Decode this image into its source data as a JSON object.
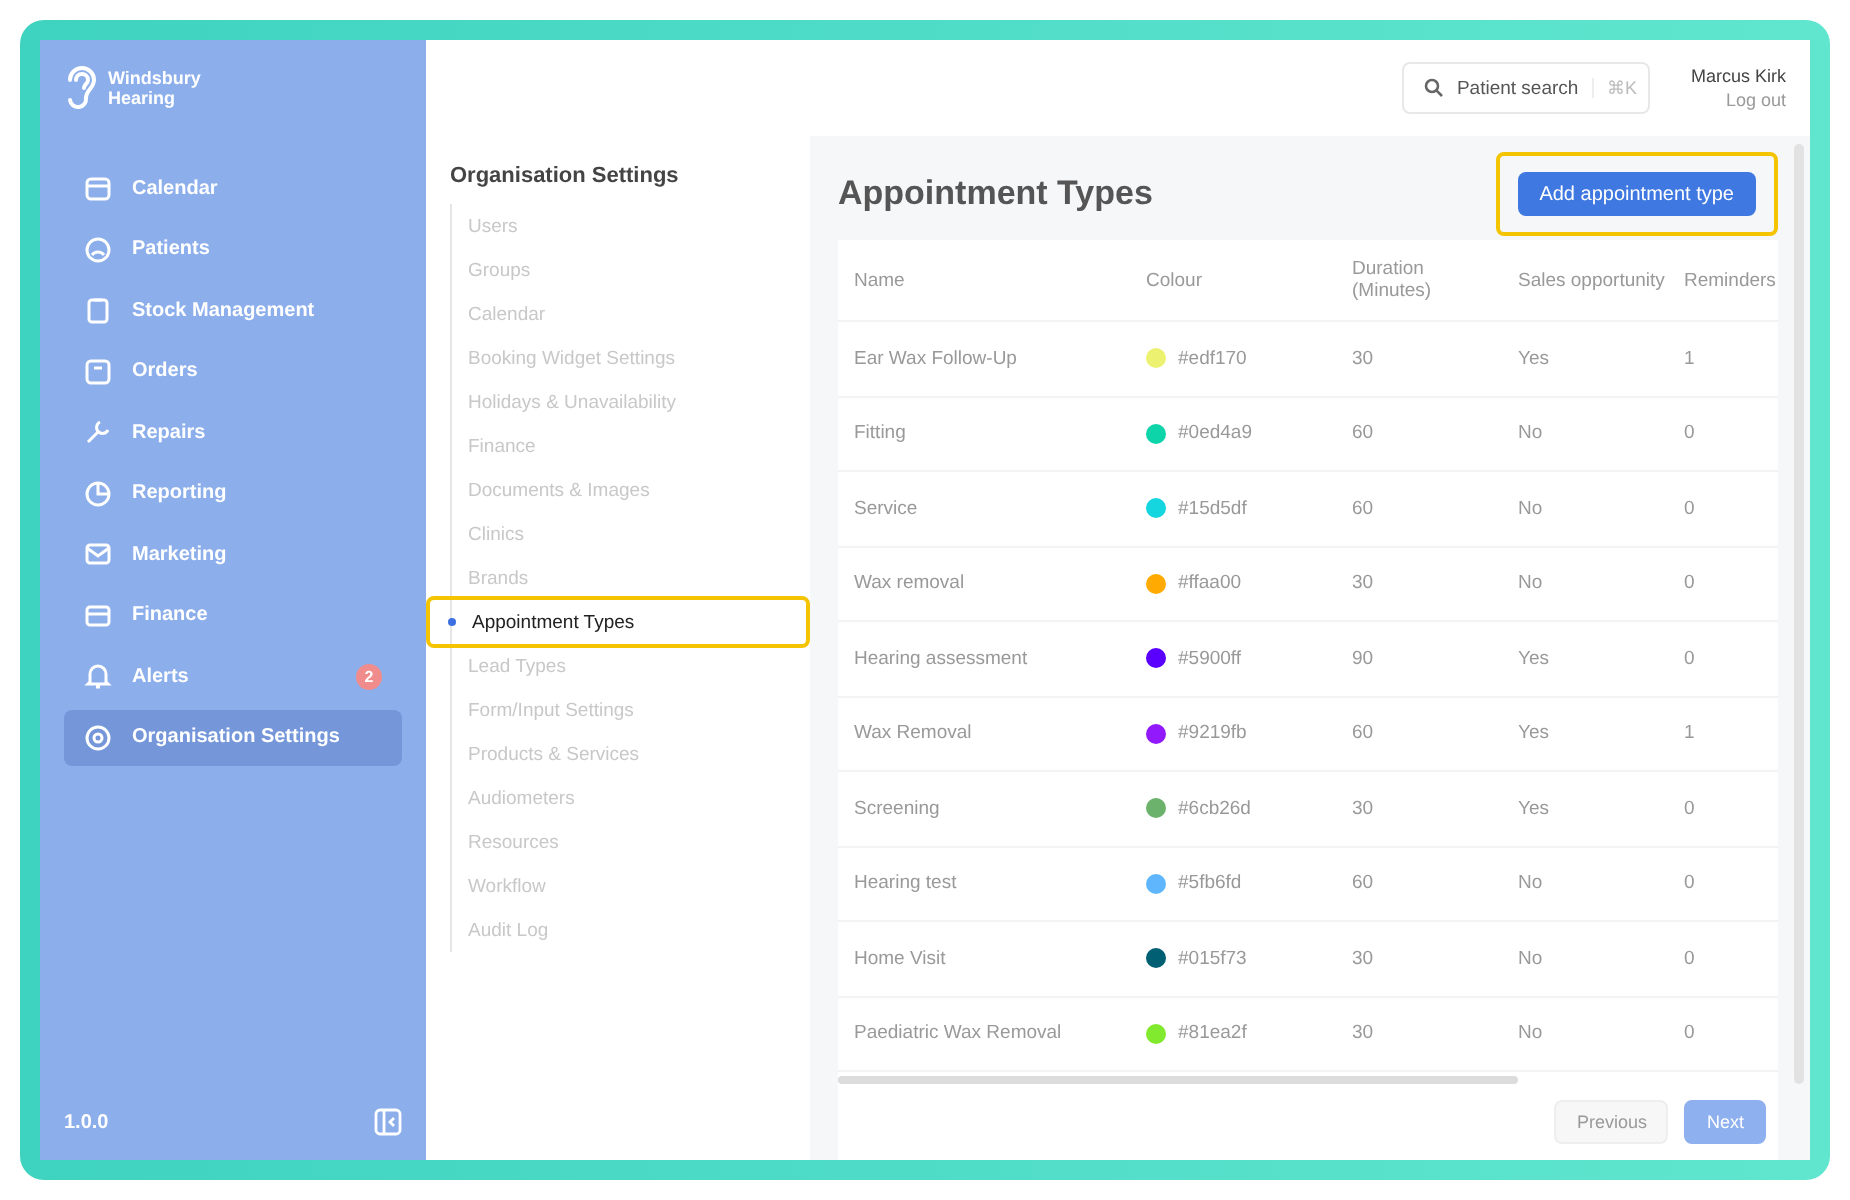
{
  "sidebar": {
    "brand": "Windsbury Hearing",
    "items": [
      {
        "label": "Calendar",
        "selected": false
      },
      {
        "label": "Patients",
        "selected": false
      },
      {
        "label": "Stock Management",
        "selected": false
      },
      {
        "label": "Orders",
        "selected": false
      },
      {
        "label": "Repairs",
        "selected": false
      },
      {
        "label": "Reporting",
        "selected": false
      },
      {
        "label": "Marketing",
        "selected": false
      },
      {
        "label": "Finance",
        "selected": false
      },
      {
        "label": "Alerts",
        "selected": false,
        "badge": "2"
      },
      {
        "label": "Organisation Settings",
        "selected": true
      }
    ],
    "version": "1.0.0"
  },
  "topbar": {
    "search": {
      "placeholder": "Patient search",
      "shortcut": "⌘K"
    },
    "user": {
      "name": "Marcus Kirk",
      "logout": "Log out"
    }
  },
  "settings_nav": {
    "title": "Organisation Settings",
    "items": [
      {
        "label": "Users",
        "selected": false,
        "highlighted": false
      },
      {
        "label": "Groups",
        "selected": false,
        "highlighted": false
      },
      {
        "label": "Calendar",
        "selected": false,
        "highlighted": false
      },
      {
        "label": "Booking Widget Settings",
        "selected": false,
        "highlighted": false
      },
      {
        "label": "Holidays & Unavailability",
        "selected": false,
        "highlighted": false
      },
      {
        "label": "Finance",
        "selected": false,
        "highlighted": false
      },
      {
        "label": "Documents & Images",
        "selected": false,
        "highlighted": false
      },
      {
        "label": "Clinics",
        "selected": false,
        "highlighted": false
      },
      {
        "label": "Brands",
        "selected": false,
        "highlighted": false
      },
      {
        "label": "Appointment Types",
        "selected": true,
        "highlighted": true
      },
      {
        "label": "Lead Types",
        "selected": false,
        "highlighted": false
      },
      {
        "label": "Form/Input Settings",
        "selected": false,
        "highlighted": false
      },
      {
        "label": "Products & Services",
        "selected": false,
        "highlighted": false
      },
      {
        "label": "Audiometers",
        "selected": false,
        "highlighted": false
      },
      {
        "label": "Resources",
        "selected": false,
        "highlighted": false
      },
      {
        "label": "Workflow",
        "selected": false,
        "highlighted": false
      },
      {
        "label": "Audit Log",
        "selected": false,
        "highlighted": false
      }
    ]
  },
  "page": {
    "title": "Appointment Types",
    "add_button": {
      "label": "Add appointment type",
      "highlighted": true
    }
  },
  "table": {
    "columns": [
      "Name",
      "Colour",
      "Duration (Minutes)",
      "Sales opportunity",
      "Reminders"
    ],
    "rows": [
      {
        "name": "Ear Wax Follow-Up",
        "color": "#edf170",
        "colour_text": "#edf170",
        "duration": "30",
        "sales": "Yes",
        "reminders": "1"
      },
      {
        "name": "Fitting",
        "color": "#0ed4a9",
        "colour_text": "#0ed4a9",
        "duration": "60",
        "sales": "No",
        "reminders": "0"
      },
      {
        "name": "Service",
        "color": "#15d5df",
        "colour_text": "#15d5df",
        "duration": "60",
        "sales": "No",
        "reminders": "0"
      },
      {
        "name": "Wax removal",
        "color": "#ffaa00",
        "colour_text": "#ffaa00",
        "duration": "30",
        "sales": "No",
        "reminders": "0"
      },
      {
        "name": "Hearing assessment",
        "color": "#5900ff",
        "colour_text": "#5900ff",
        "duration": "90",
        "sales": "Yes",
        "reminders": "0"
      },
      {
        "name": "Wax Removal",
        "color": "#9219fb",
        "colour_text": "#9219fb",
        "duration": "60",
        "sales": "Yes",
        "reminders": "1"
      },
      {
        "name": "Screening",
        "color": "#6cb26d",
        "colour_text": "#6cb26d",
        "duration": "30",
        "sales": "Yes",
        "reminders": "0"
      },
      {
        "name": "Hearing test",
        "color": "#5fb6fd",
        "colour_text": "#5fb6fd",
        "duration": "60",
        "sales": "No",
        "reminders": "0"
      },
      {
        "name": "Home Visit",
        "color": "#015f73",
        "colour_text": "#015f73",
        "duration": "30",
        "sales": "No",
        "reminders": "0"
      },
      {
        "name": "Paediatric Wax Removal",
        "color": "#81ea2f",
        "colour_text": "#81ea2f",
        "duration": "30",
        "sales": "No",
        "reminders": "0"
      }
    ]
  },
  "pagination": {
    "previous": {
      "label": "Previous",
      "disabled": true
    },
    "next": {
      "label": "Next",
      "disabled": false
    }
  }
}
